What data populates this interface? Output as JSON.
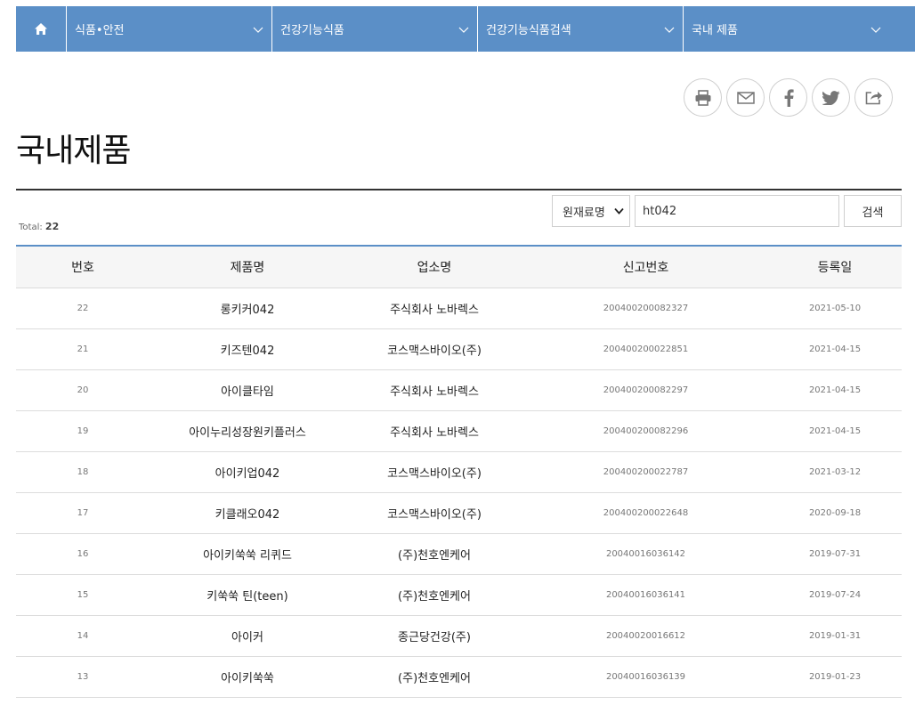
{
  "nav": {
    "items": [
      {
        "label": "식품•안전"
      },
      {
        "label": "건강기능식품"
      },
      {
        "label": "건강기능식품검색"
      },
      {
        "label": "국내 제품"
      }
    ]
  },
  "share": {
    "icons": [
      "print-icon",
      "mail-icon",
      "facebook-icon",
      "twitter-icon",
      "share-icon"
    ]
  },
  "page": {
    "title": "국내제품",
    "total_label": "Total:",
    "total_count": "22"
  },
  "search": {
    "select_value": "원재료명",
    "query": "ht042",
    "button_label": "검색"
  },
  "table": {
    "headers": [
      "번호",
      "제품명",
      "업소명",
      "신고번호",
      "등록일"
    ],
    "rows": [
      {
        "no": "22",
        "name": "롱키커042",
        "company": "주식회사 노바렉스",
        "reg": "200400200082327",
        "date": "2021-05-10"
      },
      {
        "no": "21",
        "name": "키즈텐042",
        "company": "코스맥스바이오(주)",
        "reg": "200400200022851",
        "date": "2021-04-15"
      },
      {
        "no": "20",
        "name": "아이클타임",
        "company": "주식회사 노바렉스",
        "reg": "200400200082297",
        "date": "2021-04-15"
      },
      {
        "no": "19",
        "name": "아이누리성장원키플러스",
        "company": "주식회사 노바렉스",
        "reg": "200400200082296",
        "date": "2021-04-15"
      },
      {
        "no": "18",
        "name": "아이키업042",
        "company": "코스맥스바이오(주)",
        "reg": "200400200022787",
        "date": "2021-03-12"
      },
      {
        "no": "17",
        "name": "키클래오042",
        "company": "코스맥스바이오(주)",
        "reg": "200400200022648",
        "date": "2020-09-18"
      },
      {
        "no": "16",
        "name": "아이키쑥쑥 리퀴드",
        "company": "(주)천호엔케어",
        "reg": "20040016036142",
        "date": "2019-07-31"
      },
      {
        "no": "15",
        "name": "키쑥쑥 틴(teen)",
        "company": "(주)천호엔케어",
        "reg": "20040016036141",
        "date": "2019-07-24"
      },
      {
        "no": "14",
        "name": "아이커",
        "company": "종근당건강(주)",
        "reg": "20040020016612",
        "date": "2019-01-31"
      },
      {
        "no": "13",
        "name": "아이키쑥쑥",
        "company": "(주)천호엔케어",
        "reg": "20040016036139",
        "date": "2019-01-23"
      }
    ]
  },
  "colors": {
    "nav_bg": "#5b8fc7",
    "rule": "#333333",
    "header_bg": "#f6f6f6"
  }
}
